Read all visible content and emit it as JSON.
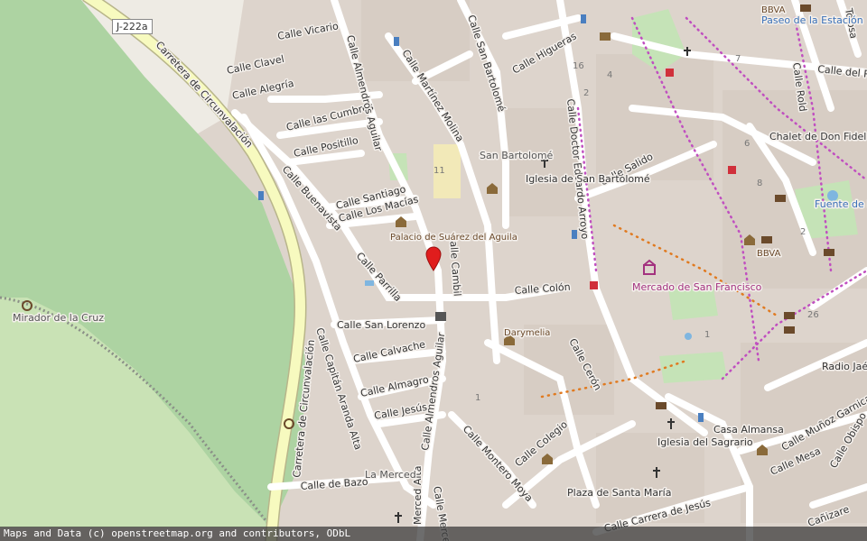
{
  "map": {
    "attribution": "Maps and Data (c) openstreetmap.org and contributors, ODbL",
    "road_ref": "J-222a",
    "colors": {
      "park": "#a8d6a0",
      "grass": "#c8e1b3",
      "built": "#ddd4cc",
      "road": "#ffffff",
      "primary": "#f7fabf",
      "marker": "#e01d1d"
    },
    "streets": {
      "carretera_1": "Carretera de Circunvalación",
      "carretera_2": "Carretera de Circunvalación",
      "vicario": "Calle Vicario",
      "clavel": "Calle Clavel",
      "alegria": "Calle Alegría",
      "cumbres": "Calle las Cumbres",
      "positillo": "Calle Positillo",
      "buenavista": "Calle Buenavista",
      "santiago": "Calle Santiago",
      "macias": "Calle Los Macías",
      "parrilla": "Calle Parrilla",
      "san_lorenzo": "Calle San Lorenzo",
      "calvache": "Calle Calvache",
      "almagro": "Calle Almagro",
      "jesus": "Calle Jesús",
      "capitan": "Calle Capitán Aranda Alta",
      "bazo": "Calle de Bazo",
      "almendros_1": "Calle Almendros Aguilar",
      "almendros_2": "Calle Almendros Aguilar",
      "martinez": "Calle Martínez Molina",
      "san_bartolome": "Calle San Bartolomé",
      "higueras": "Calle Higueras",
      "doctor": "Calle Doctor Eduardo Arroyo",
      "salido": "Calle Salido",
      "cambil": "Calle Cambil",
      "colon": "Calle Colón",
      "ceron": "Calle Cerón",
      "colegio": "Calle Colegio",
      "montero": "Calle Montero Moya",
      "carrera": "Calle Carrera de Jesús",
      "del_ro": "Calle del Ro",
      "tolosa": "Tolosa",
      "roldan": "Calle Rold",
      "munoz": "Calle Muñoz Garnica",
      "obispo": "Calle Obispo",
      "mesa": "Calle Mesa",
      "merced_alta": "Merced Alta",
      "merced": "Calle Merced",
      "canizares": "Cañizare"
    },
    "places": {
      "mirador": "Mirador de la Cruz",
      "palacio": "Palacio de Suárez del Aguila",
      "san_bartolome": "San Bartolomé",
      "iglesia_sb": "Iglesia de San Bartolomé",
      "paseo": "Paseo de la Estación",
      "chalet": "Chalet de Don Fidel",
      "fuente": "Fuente de los Botijos",
      "bbva_1": "BBVA",
      "bbva_2": "BBVA",
      "mercado": "Mercado de San Francisco",
      "darymelia": "Darymelia",
      "radio": "Radio Jaén",
      "casa": "Casa Almansa",
      "iglesia_sagrario": "Iglesia del Sagrario",
      "plaza": "Plaza de Santa María",
      "merced": "La Merced"
    },
    "house_numbers": [
      "11",
      "16",
      "2",
      "4",
      "7",
      "6",
      "8",
      "2",
      "26",
      "1",
      "1"
    ]
  }
}
